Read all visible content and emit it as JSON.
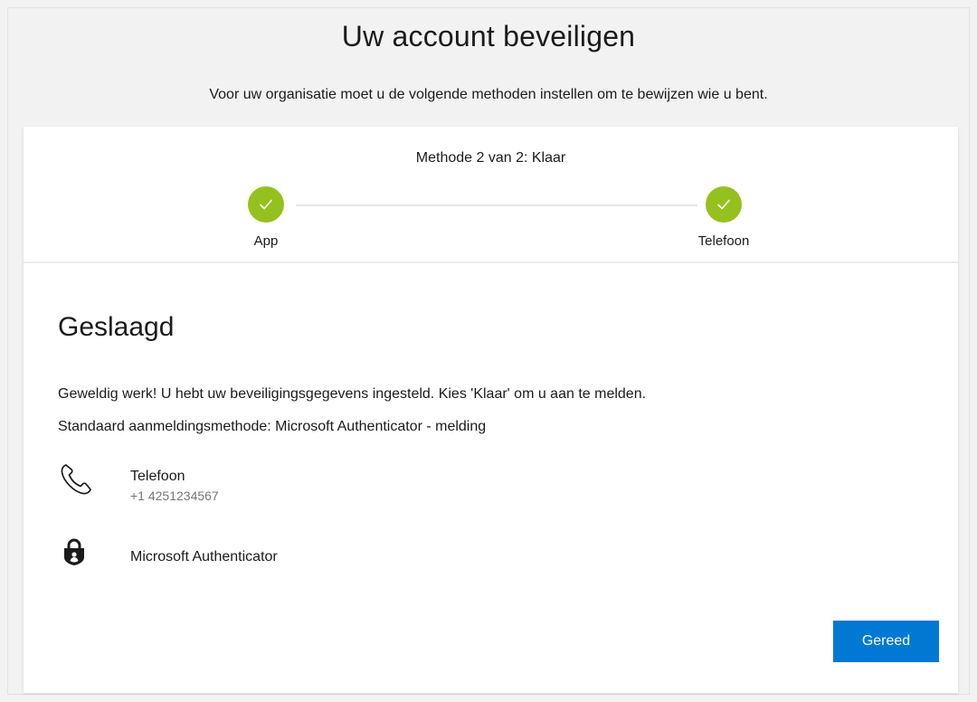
{
  "header": {
    "title": "Uw account beveiligen",
    "subtitle": "Voor uw organisatie moet u de volgende methoden instellen om te bewijzen wie u bent."
  },
  "progress": {
    "label": "Methode 2 van 2: Klaar",
    "steps": [
      {
        "label": "App",
        "status": "complete"
      },
      {
        "label": "Telefoon",
        "status": "complete"
      }
    ],
    "complete_color": "#95c11f"
  },
  "result": {
    "title": "Geslaagd",
    "message": "Geweldig werk! U hebt uw beveiligingsgegevens ingesteld. Kies 'Klaar' om u aan te melden.",
    "default_method": "Standaard aanmeldingsmethode: Microsoft Authenticator - melding"
  },
  "methods": [
    {
      "icon": "phone-icon",
      "name": "Telefoon",
      "detail": "+1 4251234567"
    },
    {
      "icon": "authenticator-lock-icon",
      "name": "Microsoft Authenticator"
    }
  ],
  "actions": {
    "done_label": "Gereed",
    "accent_color": "#0078d4"
  }
}
